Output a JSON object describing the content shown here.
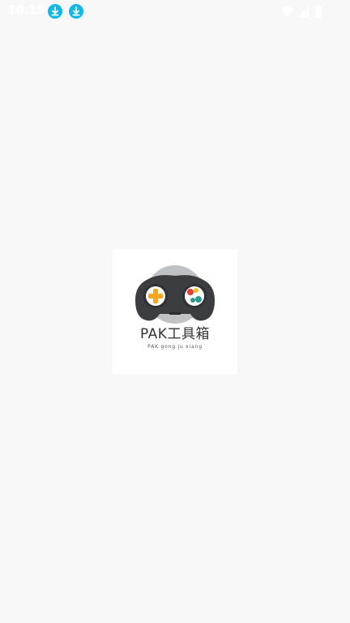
{
  "status_bar": {
    "time": "10:15",
    "notification_icons": [
      "download-icon",
      "download-icon"
    ],
    "system_icons": [
      "wifi-icon",
      "cell-signal-icon",
      "battery-icon"
    ],
    "accent_color": "#13b8ea"
  },
  "splash": {
    "logo_icon": "gamepad-icon",
    "title": "PAK工具箱",
    "subtitle": "PAK gong ju xiang"
  }
}
